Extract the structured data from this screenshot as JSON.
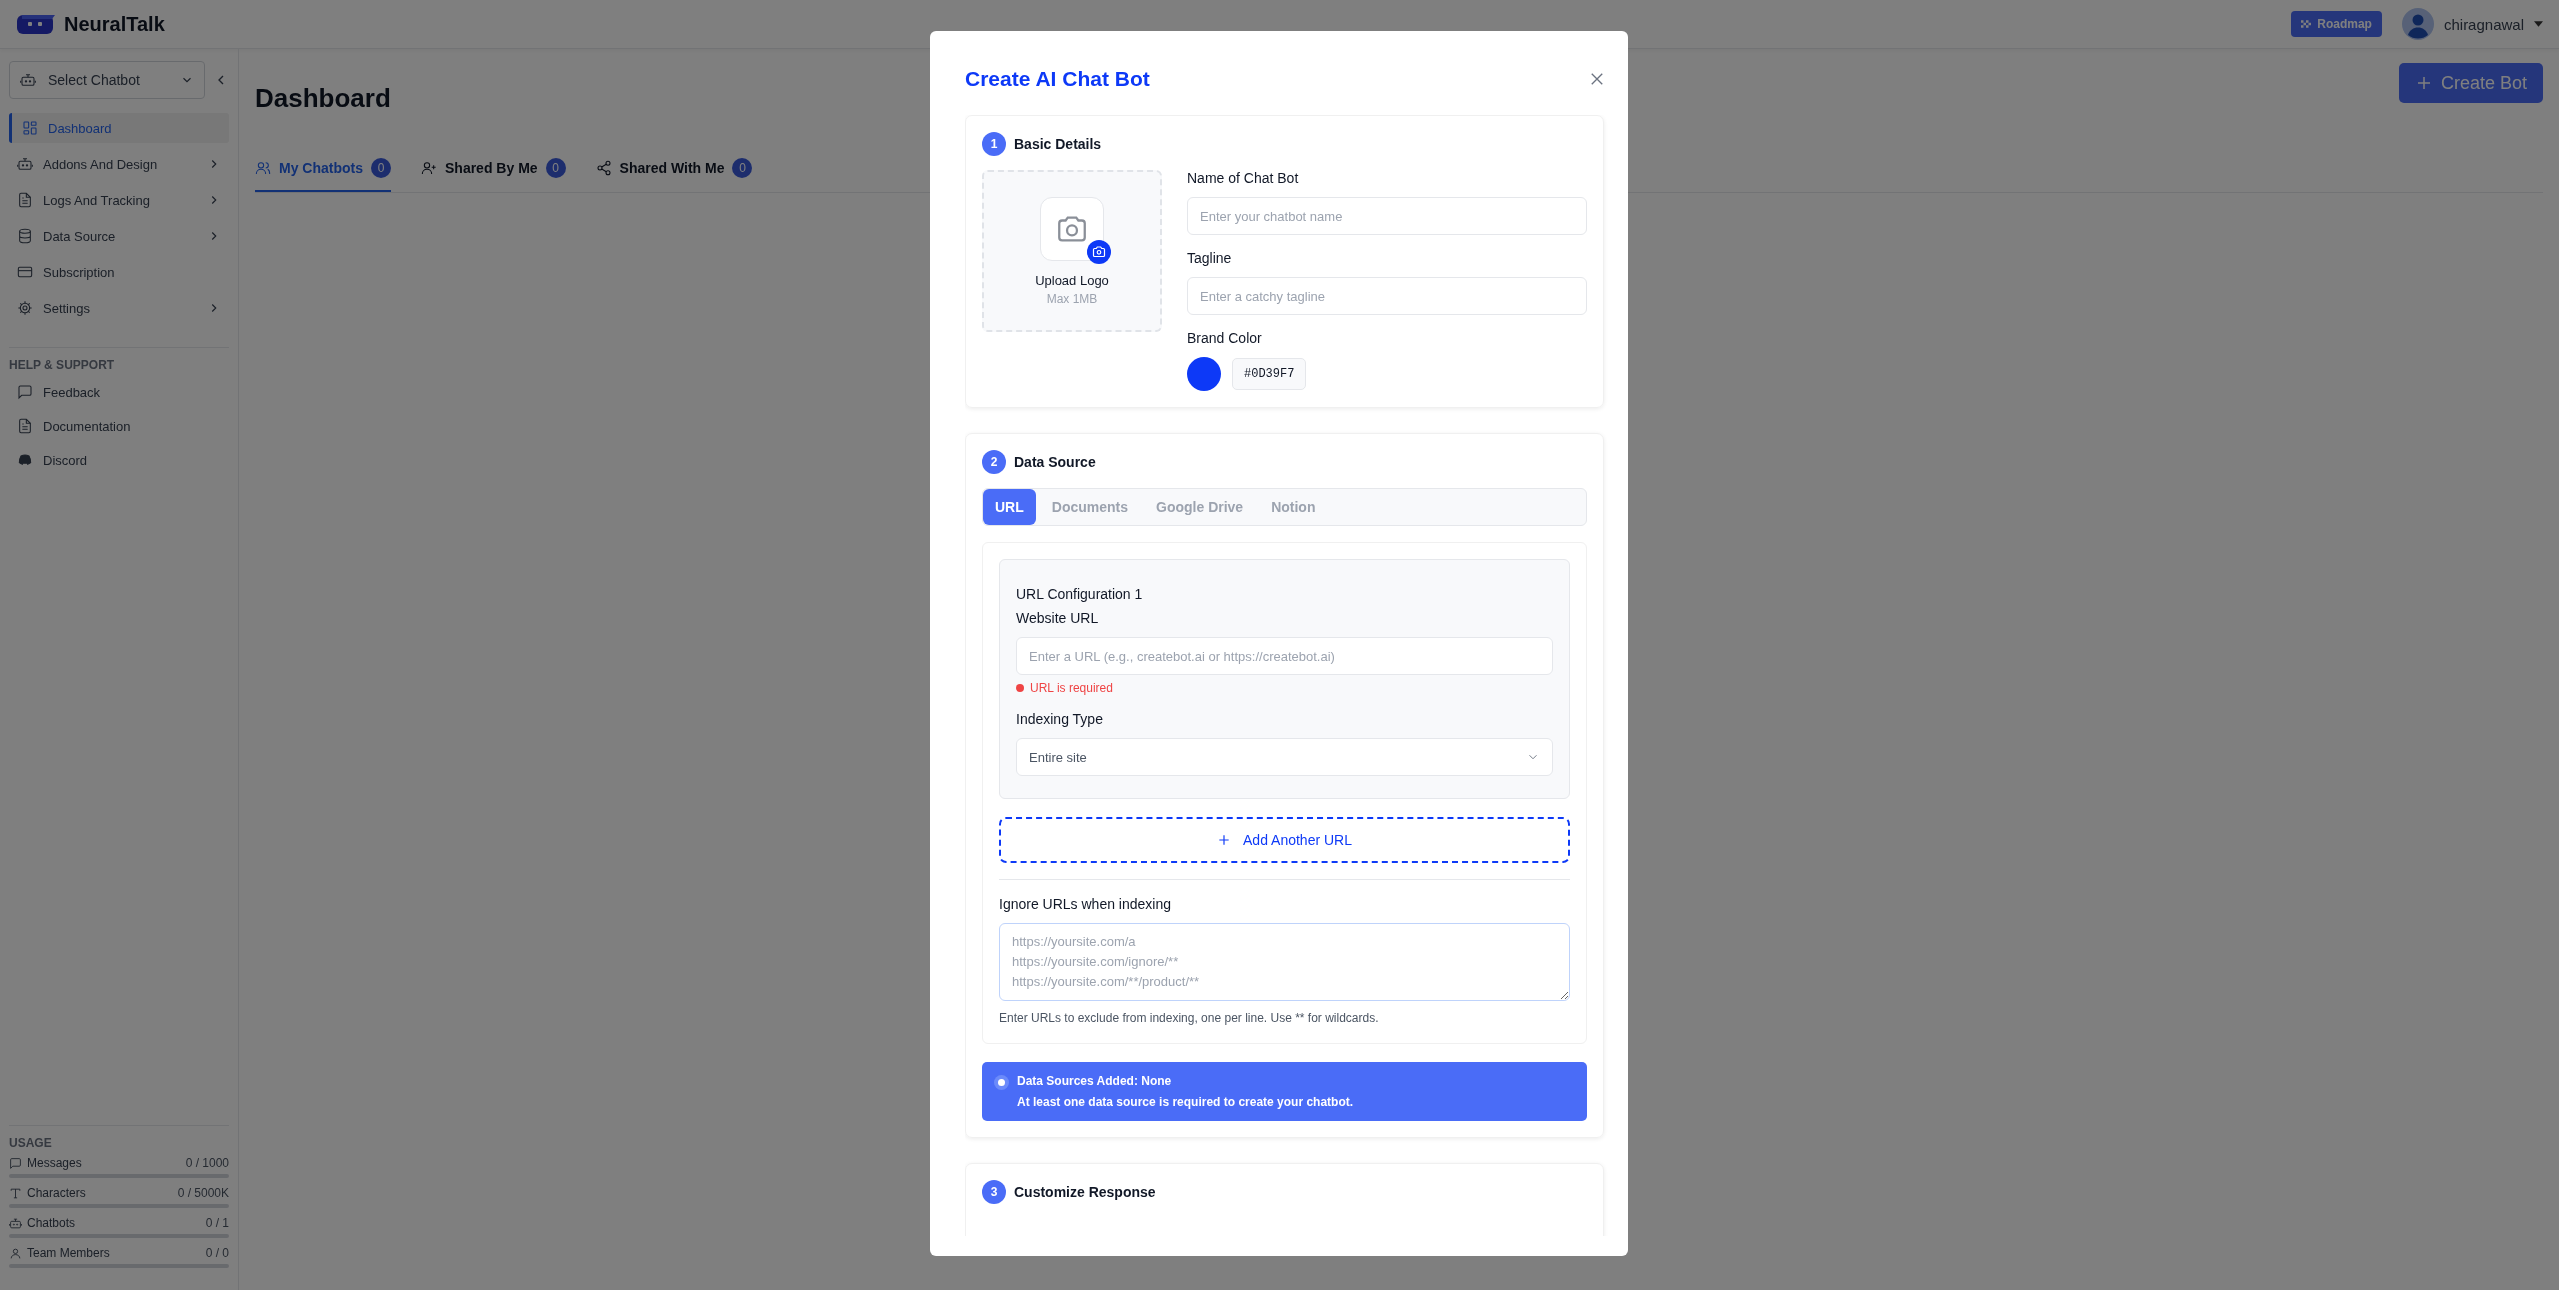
{
  "header": {
    "brand": "NeuralTalk",
    "roadmap_button": "Roadmap",
    "username": "chiragnawal"
  },
  "sidebar": {
    "chatbot_select": "Select Chatbot",
    "nav": [
      {
        "label": "Dashboard",
        "selected": true,
        "expandable": false
      },
      {
        "label": "Addons And Design",
        "selected": false,
        "expandable": true
      },
      {
        "label": "Logs And Tracking",
        "selected": false,
        "expandable": true
      },
      {
        "label": "Data Source",
        "selected": false,
        "expandable": true
      },
      {
        "label": "Subscription",
        "selected": false,
        "expandable": false
      },
      {
        "label": "Settings",
        "selected": false,
        "expandable": true
      }
    ],
    "help_heading": "HELP & SUPPORT",
    "help": [
      {
        "label": "Feedback"
      },
      {
        "label": "Documentation"
      },
      {
        "label": "Discord"
      }
    ],
    "usage_heading": "USAGE",
    "usage": [
      {
        "label": "Messages",
        "value": "0 / 1000",
        "level": 0
      },
      {
        "label": "Characters",
        "value": "0 / 5000K",
        "level": 0
      },
      {
        "label": "Chatbots",
        "value": "0 / 1",
        "level": 0
      },
      {
        "label": "Team Members",
        "value": "0 / 0",
        "level": 0
      }
    ]
  },
  "main": {
    "title": "Dashboard",
    "create_button": "Create Bot",
    "tabs": [
      {
        "label": "My Chatbots",
        "count": "0",
        "selected": true
      },
      {
        "label": "Shared By Me",
        "count": "0",
        "selected": false
      },
      {
        "label": "Shared With Me",
        "count": "0",
        "selected": false
      }
    ]
  },
  "modal": {
    "title": "Create AI Chat Bot",
    "basic": {
      "number": "1",
      "title": "Basic Details",
      "upload_label": "Upload Logo",
      "upload_hint": "Max 1MB",
      "name_label": "Name of Chat Bot",
      "name_placeholder": "Enter your chatbot name",
      "tagline_label": "Tagline",
      "tagline_placeholder": "Enter a catchy tagline",
      "brand_color_label": "Brand Color",
      "brand_color": "#0D39F7"
    },
    "data_source": {
      "number": "2",
      "title": "Data Source",
      "tabs": [
        {
          "label": "URL",
          "selected": true
        },
        {
          "label": "Documents",
          "selected": false
        },
        {
          "label": "Google Drive",
          "selected": false
        },
        {
          "label": "Notion",
          "selected": false
        }
      ],
      "config_title": "URL Configuration 1",
      "website_label": "Website URL",
      "url_placeholder": "Enter a URL (e.g., createbot.ai or https://createbot.ai)",
      "error": "URL is required",
      "indexing_label": "Indexing Type",
      "indexing_value": "Entire site",
      "add_button": "Add Another URL",
      "ignore_label": "Ignore URLs when indexing",
      "ignore_placeholder": "https://yoursite.com/a\nhttps://yoursite.com/ignore/**\nhttps://yoursite.com/**/product/**",
      "ignore_hint": "Enter URLs to exclude from indexing, one per line. Use ** for wildcards.",
      "banner_title": "Data Sources Added: None",
      "banner_text": "At least one data source is required to create your chatbot."
    },
    "customize": {
      "number": "3",
      "title": "Customize Response"
    }
  }
}
